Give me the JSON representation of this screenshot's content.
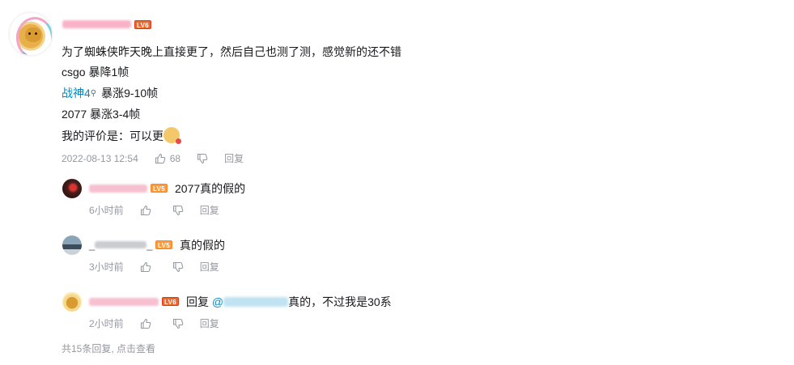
{
  "comment": {
    "user_level": "LV6",
    "lines": {
      "l1": "为了蜘蛛侠昨天晚上直接更了，然后自己也测了测，感觉新的还不错",
      "l2": "csgo 暴降1帧",
      "l3_link": "战神4",
      "l3_search": "⚲",
      "l3_rest": "暴涨9-10帧",
      "l4": "2077 暴涨3-4帧",
      "l5": "我的评价是：可以更"
    },
    "time": "2022-08-13 12:54",
    "likes": "68",
    "reply_label": "回复"
  },
  "replies": [
    {
      "level": "LV5",
      "text": "2077真的假的",
      "time": "6小时前",
      "reply_label": "回复"
    },
    {
      "username_visible": "_",
      "username_tail": "_",
      "level": "LV5",
      "text": "真的假的",
      "time": "3小时前",
      "reply_label": "回复"
    },
    {
      "level": "LV6",
      "reply_prefix": "回复",
      "at": "@",
      "text": "真的，不过我是30系",
      "time": "2小时前",
      "reply_label": "回复"
    }
  ],
  "footer": "共15条回复, 点击查看",
  "colors": {
    "link": "#008ac5",
    "meta": "#9499a0",
    "lv6": "#ee672a",
    "lv5": "#ff9a36",
    "username_pink": "#fb7299"
  },
  "icons": [
    "thumb-up-icon",
    "thumb-down-icon",
    "search-icon"
  ]
}
